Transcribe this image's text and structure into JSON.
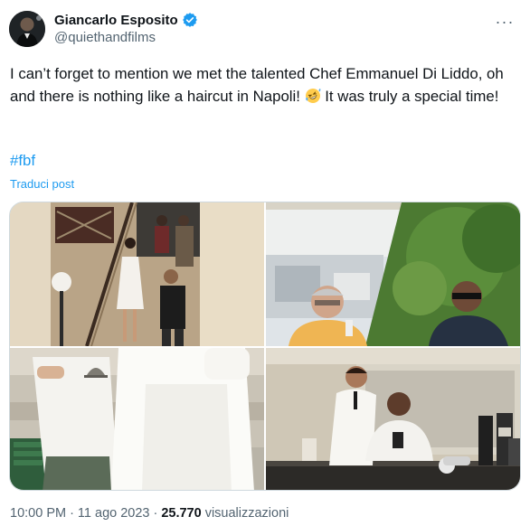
{
  "author": {
    "display_name": "Giancarlo Esposito",
    "handle": "@quiethandfilms",
    "verified": true,
    "avatar_icon": "avatar-photo"
  },
  "tweet": {
    "text_part1": "I can’t forget to mention we met the talented Chef Emmanuel Di Liddo, oh and there is nothing like a haircut in Napoli! ",
    "emoji": "rolling-on-the-floor-laughing-emoji",
    "text_part2": " It was truly a special time!",
    "hashtag": "#fbf",
    "translate_label": "Traduci post"
  },
  "media": {
    "photos": [
      {
        "id": "staircase-photo",
        "alt_icon": "photo-staircase"
      },
      {
        "id": "terrace-photo",
        "alt_icon": "photo-terrace"
      },
      {
        "id": "bakery-photo",
        "alt_icon": "photo-bakery"
      },
      {
        "id": "barber-photo",
        "alt_icon": "photo-barber"
      }
    ]
  },
  "meta": {
    "time": "10:00 PM",
    "separator": "·",
    "date": "11 ago 2023",
    "views_count": "25.770",
    "views_label": "visualizzazioni"
  },
  "colors": {
    "text": "#0f1419",
    "secondary": "#536471",
    "link": "#1d9bf0",
    "verified": "#1d9bf0",
    "border": "#cfd9de"
  }
}
